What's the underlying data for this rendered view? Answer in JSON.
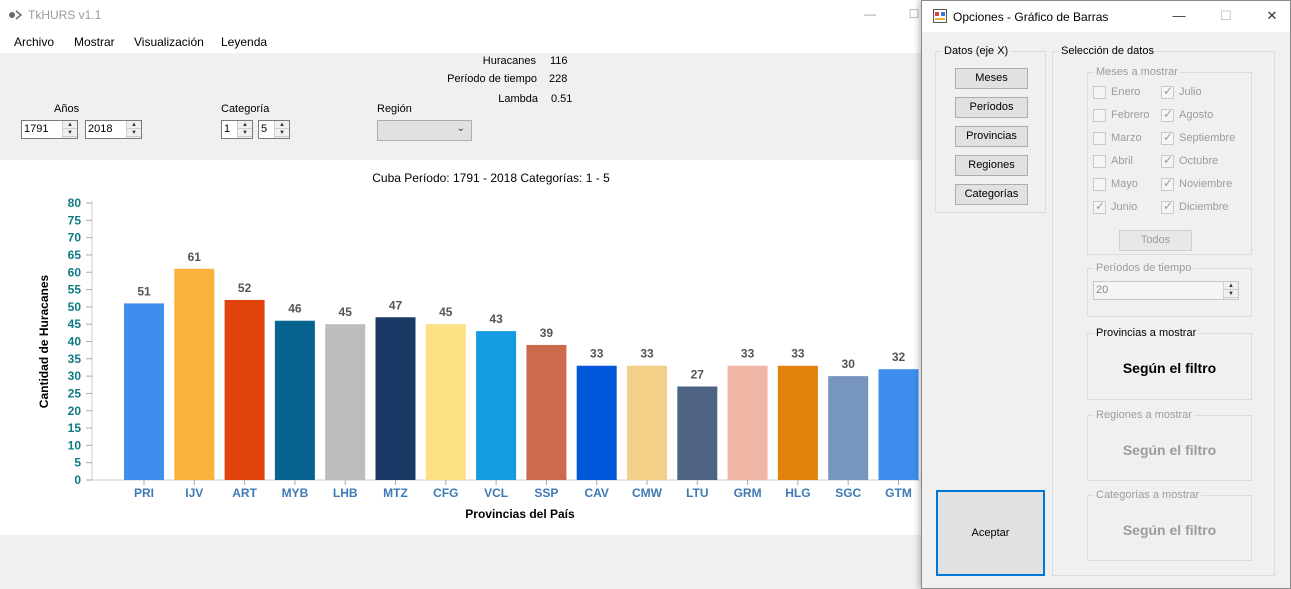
{
  "window": {
    "title": "TkHURS v1.1",
    "minimize": "—",
    "maximize": "☐"
  },
  "menu": [
    "Archivo",
    "Mostrar",
    "Visualización",
    "Leyenda"
  ],
  "stats": [
    {
      "label": "Huracanes",
      "value": "116"
    },
    {
      "label": "Período de tiempo",
      "value": "228"
    },
    {
      "label": "Lambda",
      "value": "0.51"
    }
  ],
  "filters": {
    "years_label": "Años",
    "year_from": "1791",
    "year_to": "2018",
    "category_label": "Categoría",
    "category_from": "1",
    "category_to": "5",
    "region_label": "Región",
    "region_value": ""
  },
  "chart_data": {
    "type": "bar",
    "title": "Cuba Período: 1791 - 2018 Categorías: 1 - 5",
    "xlabel": "Provincias del País",
    "ylabel": "Cantidad de Huracanes",
    "ylim": [
      0,
      80
    ],
    "yticks": [
      0,
      5,
      10,
      15,
      20,
      25,
      30,
      35,
      40,
      45,
      50,
      55,
      60,
      65,
      70,
      75,
      80
    ],
    "categories": [
      "PRI",
      "IJV",
      "ART",
      "MYB",
      "LHB",
      "MTZ",
      "CFG",
      "VCL",
      "SSP",
      "CAV",
      "CMW",
      "LTU",
      "GRM",
      "HLG",
      "SGC",
      "GTM"
    ],
    "values": [
      51,
      61,
      52,
      46,
      45,
      47,
      45,
      43,
      39,
      33,
      33,
      27,
      33,
      33,
      30,
      32
    ],
    "colors": [
      "#3f8ded",
      "#f9b23c",
      "#e0430c",
      "#06648f",
      "#bdbdbd",
      "#1a3866",
      "#fde081",
      "#159be0",
      "#cc6a4e",
      "#0057d9",
      "#f2d087",
      "#4e6382",
      "#f0b7a6",
      "#e0820c",
      "#7895bf",
      "#3f8ded"
    ],
    "grid": false,
    "legend": "none"
  },
  "dialog": {
    "title": "Opciones - Gráfico de Barras",
    "minimize": "—",
    "maximize": "☐",
    "close": "✕",
    "datos_group": "Datos (eje X)",
    "datos_buttons": [
      "Meses",
      "Períodos",
      "Provincias",
      "Regiones",
      "Categorías"
    ],
    "seleccion_group": "Selección de datos",
    "meses_group": "Meses a mostrar",
    "months_left": [
      {
        "label": "Enero",
        "checked": false
      },
      {
        "label": "Febrero",
        "checked": false
      },
      {
        "label": "Marzo",
        "checked": false
      },
      {
        "label": "Abril",
        "checked": false
      },
      {
        "label": "Mayo",
        "checked": false
      },
      {
        "label": "Junio",
        "checked": true
      }
    ],
    "months_right": [
      {
        "label": "Julio",
        "checked": true
      },
      {
        "label": "Agosto",
        "checked": true
      },
      {
        "label": "Septiembre",
        "checked": true
      },
      {
        "label": "Octubre",
        "checked": true
      },
      {
        "label": "Noviembre",
        "checked": true
      },
      {
        "label": "Diciembre",
        "checked": true
      }
    ],
    "todos_label": "Todos",
    "periodos_group": "Períodos de tiempo",
    "periodos_value": "20",
    "provincias_group": "Provincias a mostrar",
    "provincias_text": "Según el filtro",
    "regiones_group": "Regiones a mostrar",
    "regiones_text": "Según el filtro",
    "categorias_group": "Categorías a mostrar",
    "categorias_text": "Según el filtro",
    "accept_label": "Aceptar"
  }
}
